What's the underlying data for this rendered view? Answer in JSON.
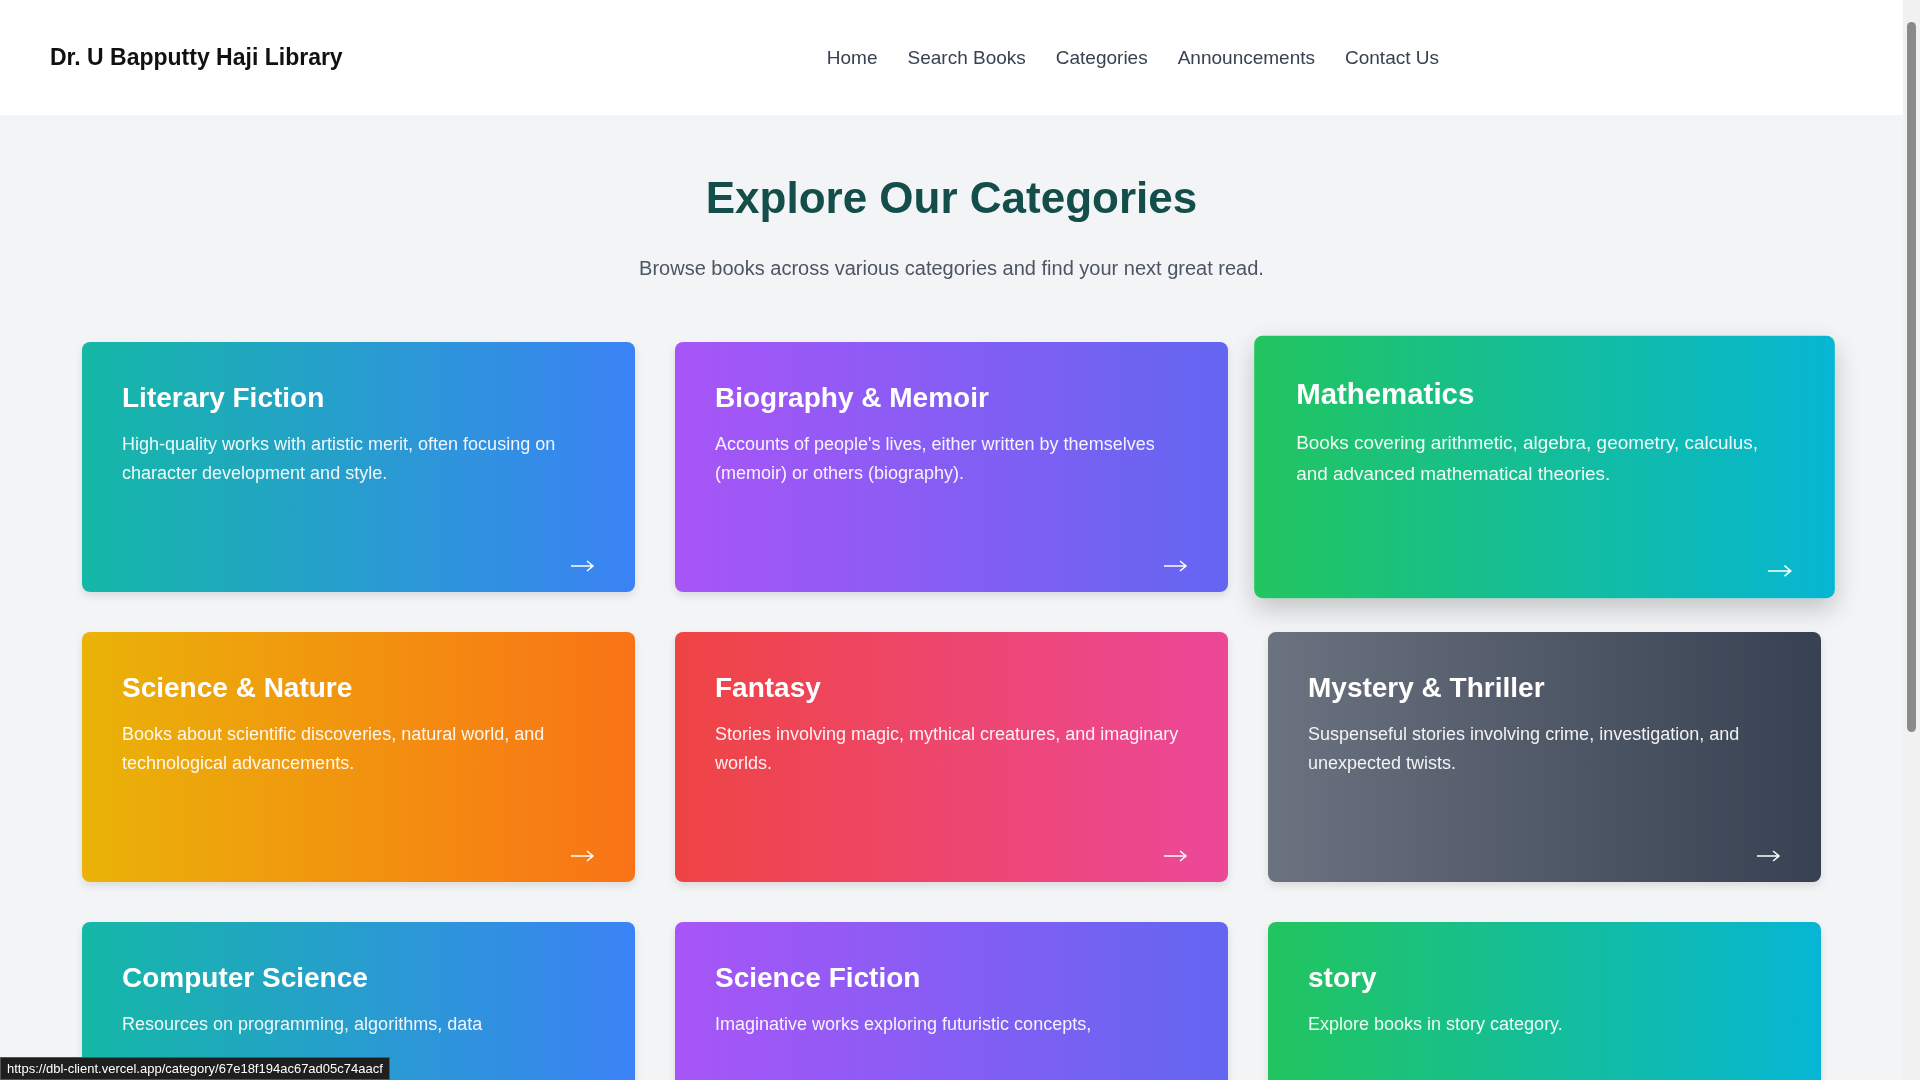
{
  "header": {
    "brand": "Dr. U Bapputty Haji Library",
    "nav": [
      {
        "label": "Home"
      },
      {
        "label": "Search Books"
      },
      {
        "label": "Categories"
      },
      {
        "label": "Announcements"
      },
      {
        "label": "Contact Us"
      }
    ]
  },
  "hero": {
    "title": "Explore Our Categories",
    "subtitle": "Browse books across various categories and find your next great read."
  },
  "categories": [
    {
      "title": "Literary Fiction",
      "description": "High-quality works with artistic merit, often focusing on character development and style.",
      "kind": "ocean",
      "hovered": false
    },
    {
      "title": "Biography & Memoir",
      "description": "Accounts of people's lives, either written by themselves (memoir) or others (biography).",
      "kind": "violet",
      "hovered": false
    },
    {
      "title": "Mathematics",
      "description": "Books covering arithmetic, algebra, geometry, calculus, and advanced mathematical theories.",
      "kind": "emerald",
      "hovered": true
    },
    {
      "title": "Science & Nature",
      "description": "Books about scientific discoveries, natural world, and technological advancements.",
      "kind": "amber",
      "hovered": false
    },
    {
      "title": "Fantasy",
      "description": "Stories involving magic, mythical creatures, and imaginary worlds.",
      "kind": "rose",
      "hovered": false
    },
    {
      "title": "Mystery & Thriller",
      "description": "Suspenseful stories involving crime, investigation, and unexpected twists.",
      "kind": "slate",
      "hovered": false
    },
    {
      "title": "Computer Science",
      "description": "Resources on programming, algorithms, data",
      "kind": "ocean",
      "hovered": false
    },
    {
      "title": "Science Fiction",
      "description": "Imaginative works exploring futuristic concepts,",
      "kind": "violet",
      "hovered": false
    },
    {
      "title": "story",
      "description": "Explore books in story category.",
      "kind": "emerald",
      "hovered": false
    }
  ],
  "status_bar": {
    "url": "https://dbl-client.vercel.app/category/67e18f194ac67ad05c74aacf"
  }
}
